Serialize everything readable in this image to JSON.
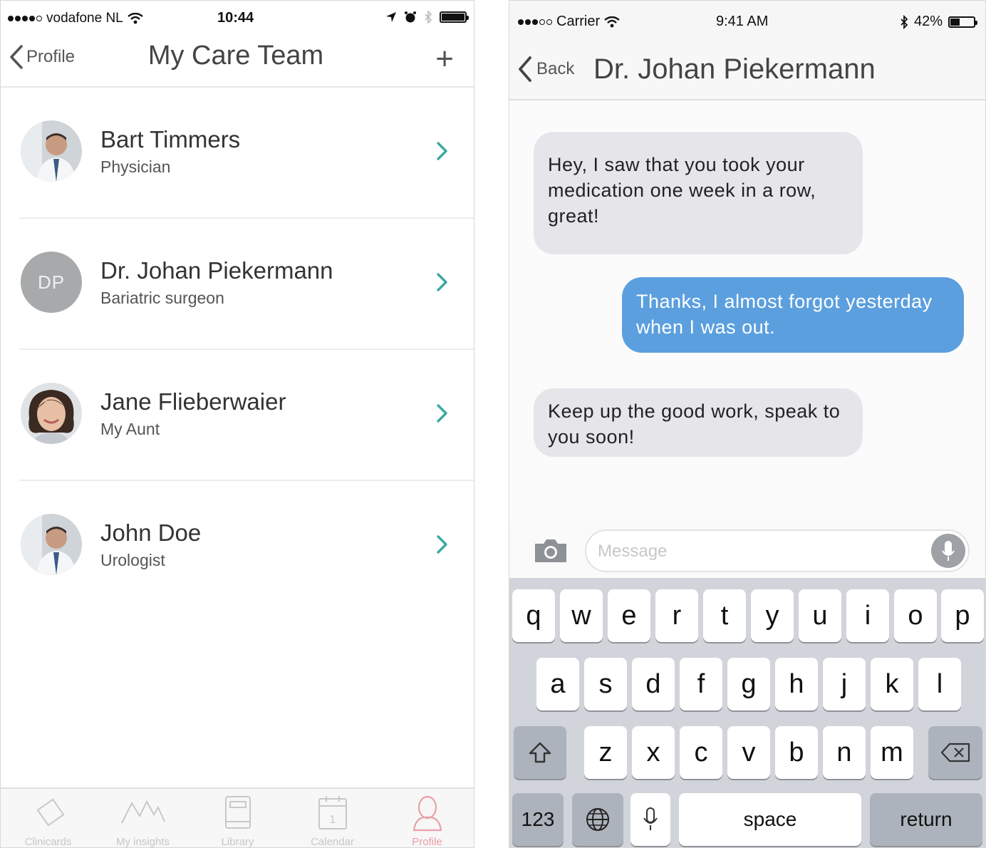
{
  "left_phone": {
    "status": {
      "carrier": "vodafone NL",
      "time": "10:44"
    },
    "nav": {
      "back_label": "Profile",
      "title": "My Care Team",
      "add_label": "+"
    },
    "contacts": [
      {
        "name": "Bart Timmers",
        "role": "Physician",
        "avatar": "photo"
      },
      {
        "name": "Dr. Johan Piekermann",
        "role": "Bariatric surgeon",
        "avatar": "initials",
        "initials": "DP"
      },
      {
        "name": "Jane Flieberwaier",
        "role": "My Aunt",
        "avatar": "photo"
      },
      {
        "name": "John Doe",
        "role": "Urologist",
        "avatar": "photo"
      }
    ],
    "tabs": [
      {
        "label": "Clinicards",
        "icon": "cards-icon"
      },
      {
        "label": "My insights",
        "icon": "insights-chart-icon"
      },
      {
        "label": "Library",
        "icon": "book-icon"
      },
      {
        "label": "Calendar",
        "icon": "calendar-icon",
        "day": "1"
      },
      {
        "label": "Profile",
        "icon": "person-icon",
        "active": true
      }
    ]
  },
  "right_phone": {
    "status": {
      "carrier": "Carrier",
      "time": "9:41 AM",
      "battery": "42%",
      "battery_level": 0.42
    },
    "nav": {
      "back_label": "Back",
      "title": "Dr. Johan Piekermann"
    },
    "messages": [
      {
        "direction": "incoming",
        "text": "Hey, I saw that you took your medication one week in a row, great!"
      },
      {
        "direction": "outgoing",
        "text": "Thanks, I almost forgot yesterday when I was out."
      },
      {
        "direction": "incoming",
        "text": "Keep up the good work, speak to you soon!"
      }
    ],
    "composer": {
      "placeholder": "Message"
    },
    "keyboard": {
      "row1": [
        "q",
        "w",
        "e",
        "r",
        "t",
        "y",
        "u",
        "i",
        "o",
        "p"
      ],
      "row2": [
        "a",
        "s",
        "d",
        "f",
        "g",
        "h",
        "j",
        "k",
        "l"
      ],
      "row3": [
        "z",
        "x",
        "c",
        "v",
        "b",
        "n",
        "m"
      ],
      "numbers_label": "123",
      "space_label": "space",
      "return_label": "return"
    }
  },
  "colors": {
    "accent_teal": "#3aa9a0",
    "active_tab": "#e9a0a8",
    "outgoing_bubble": "#5b9fde",
    "incoming_bubble": "#e6e6ea",
    "initials_avatar": "#a7a9ab"
  }
}
